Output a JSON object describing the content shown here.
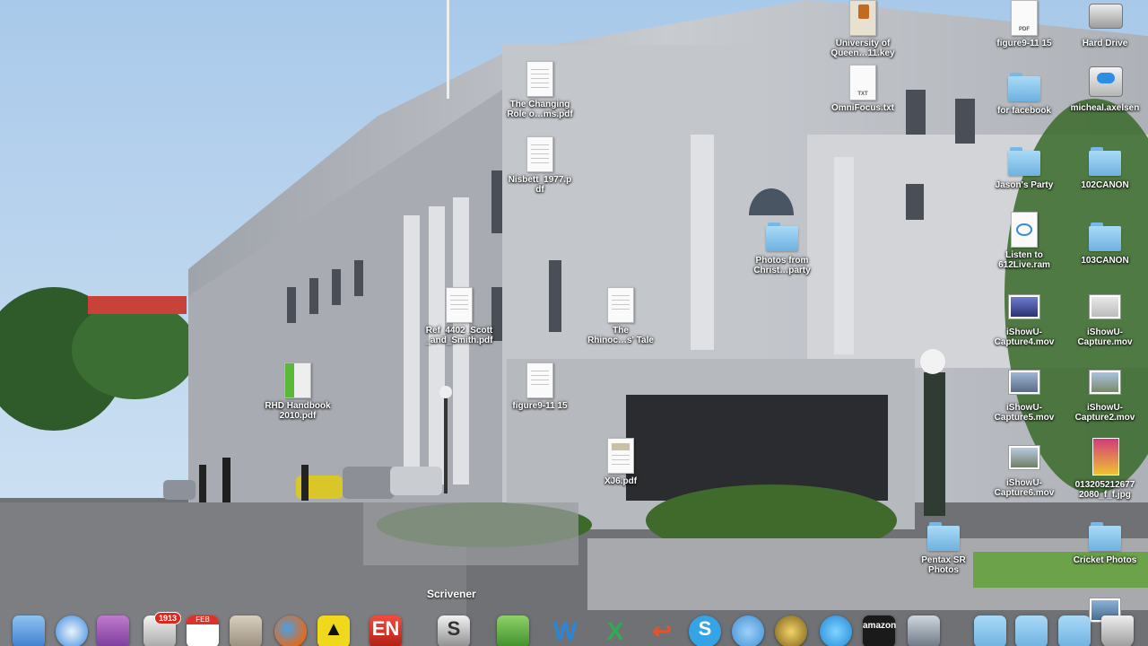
{
  "desktop_icons": [
    {
      "label": "University of\nQueen…11.key"
    },
    {
      "label": "figure9-11 15",
      "tag": "PDF"
    },
    {
      "label": "Hard Drive"
    },
    {
      "label": "The Changing\nRole o…ms.pdf"
    },
    {
      "label": "OmniFocus.txt",
      "tag": "TXT"
    },
    {
      "label": "for facebook"
    },
    {
      "label": "micheal.axelsen"
    },
    {
      "label": "Nisbett_1977.p\ndf"
    },
    {
      "label": "Jason's Party"
    },
    {
      "label": "102CANON"
    },
    {
      "label": "Photos from\nChrist…party"
    },
    {
      "label": "Listen to\n612Live.ram"
    },
    {
      "label": "103CANON"
    },
    {
      "label": "Ref_4402_Scott\n_and_Smith.pdf"
    },
    {
      "label": "The\nRhinoc…s' Tale"
    },
    {
      "label": "iShowU-\nCapture4.mov"
    },
    {
      "label": "iShowU-\nCapture.mov"
    },
    {
      "label": "RHD Handbook\n2010.pdf"
    },
    {
      "label": "figure9-11 15"
    },
    {
      "label": "iShowU-\nCapture5.mov"
    },
    {
      "label": "iShowU-\nCapture2.mov"
    },
    {
      "label": "XJ6.pdf"
    },
    {
      "label": "iShowU-\nCapture6.mov"
    },
    {
      "label": "013205212677\n2080_f_f.jpg"
    },
    {
      "label": "Pentax SR\nPhotos"
    },
    {
      "label": "Cricket Photos"
    }
  ],
  "dock": {
    "tooltip": "Scrivener",
    "mail_badge": "1913",
    "calendar_month": "FEB",
    "amazon_label": "amazon",
    "evernote_label": "EN"
  },
  "colors": {
    "sky": "#bcd6ef",
    "stone": "#b9bcc2",
    "folder": "#8ccaf0"
  }
}
